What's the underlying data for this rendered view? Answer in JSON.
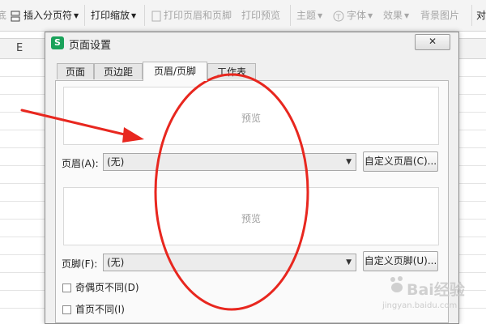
{
  "ribbon": {
    "partial_left": "底",
    "insert_page_number": "插入分页符",
    "print_scale": "打印缩放",
    "print_header_footer": "打印页眉和页脚",
    "print_preview": "打印预览",
    "theme": "主题",
    "font": "字体",
    "effects": "效果",
    "background_image": "背景图片",
    "partial_right": "对"
  },
  "sheet": {
    "column_label": "E"
  },
  "dialog": {
    "title": "页面设置",
    "close": "✕",
    "tabs": [
      "页面",
      "页边距",
      "页眉/页脚",
      "工作表"
    ],
    "active_tab": "页眉/页脚",
    "header_preview": "预览",
    "header_label": "页眉(A):",
    "header_value": "(无)",
    "custom_header_button": "自定义页眉(C)...",
    "footer_preview": "预览",
    "footer_label": "页脚(F):",
    "footer_value": "(无)",
    "custom_footer_button": "自定义页脚(U)...",
    "odd_even_label": "奇偶页不同(D)",
    "odd_even_checked": false,
    "first_page_label": "首页不同(I)",
    "first_page_checked": false
  },
  "watermark": {
    "brand": "Bai经验",
    "url": "jingyan.baidu.com"
  },
  "colors": {
    "annotation_red": "#e8271f",
    "wps_green": "#1aa25a",
    "active_tab_bg": "#fafafa"
  }
}
